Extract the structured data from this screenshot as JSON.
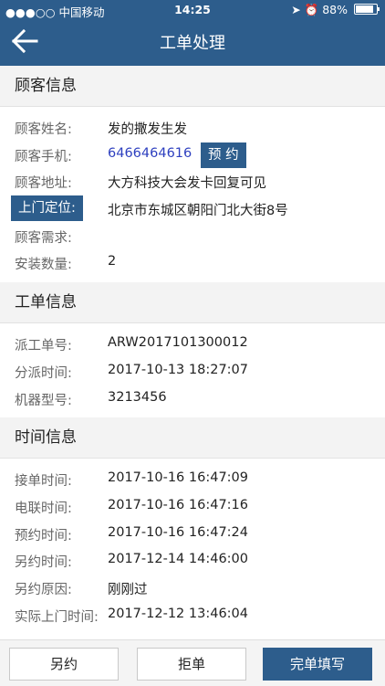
{
  "status_bar": {
    "carrier": "●●●○○ 中国移动",
    "time": "14:25",
    "battery": "88%",
    "battery_level": 0.88
  },
  "nav": {
    "title": "工单处理"
  },
  "customer": {
    "section_title": "顾客信息",
    "name_label": "顾客姓名:",
    "name": "发的撒发生发",
    "phone_label": "顾客手机:",
    "phone": "6466464616",
    "appointment_button": "预 约",
    "address_label": "顾客地址:",
    "address": "大方科技大会发卡回复可见",
    "location_button": "上门定位:",
    "location": "北京市东城区朝阳门北大街8号",
    "needs_label": "顾客需求:",
    "needs": "",
    "quantity_label": "安装数量:",
    "quantity": "2"
  },
  "workorder": {
    "section_title": "工单信息",
    "dispatch_no_label": "派工单号:",
    "dispatch_no": "ARW2017101300012",
    "dispatch_time_label": "分派时间:",
    "dispatch_time": "2017-10-13 18:27:07",
    "model_label": "机器型号:",
    "model": "3213456"
  },
  "time_info": {
    "section_title": "时间信息",
    "accept_label": "接单时间:",
    "accept": "2017-10-16 16:47:09",
    "call_label": "电联时间:",
    "call": "2017-10-16 16:47:16",
    "appoint_label": "预约时间:",
    "appoint": "2017-10-16 16:47:24",
    "reappoint_label": "另约时间:",
    "reappoint": "2017-12-14 14:46:00",
    "reason_label": "另约原因:",
    "reason": "刚刚过",
    "actual_label": "实际上门时间:",
    "actual": "2017-12-12 13:46:04"
  },
  "footer": {
    "reschedule": "另约",
    "reject": "拒单",
    "complete": "完单填写"
  },
  "colors": {
    "primary": "#2d5d8c",
    "phone": "#2d3fbf"
  }
}
